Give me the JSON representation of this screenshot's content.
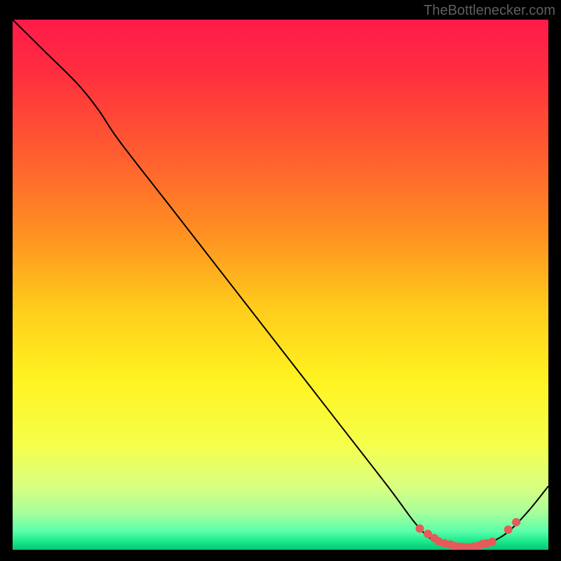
{
  "attribution": "TheBottlenecker.com",
  "chart_data": {
    "type": "line",
    "title": "",
    "xlabel": "",
    "ylabel": "",
    "xlim": [
      0,
      100
    ],
    "ylim": [
      0,
      100
    ],
    "series": [
      {
        "name": "curve",
        "x": [
          0,
          6,
          12,
          16,
          20,
          30,
          40,
          50,
          60,
          70,
          76,
          80,
          84,
          88,
          92,
          96,
          100
        ],
        "y": [
          100,
          94,
          88,
          83,
          77,
          64,
          51,
          38,
          25,
          12,
          4,
          1,
          0.5,
          1,
          3,
          7,
          12
        ]
      }
    ],
    "markers": {
      "name": "dots",
      "x": [
        76,
        77.5,
        78.7,
        79.5,
        80.6,
        81.7,
        82.5,
        83.5,
        84.2,
        85.0,
        86.0,
        87.0,
        87.8,
        88.5,
        89.5,
        92.5,
        94.0
      ],
      "y": [
        4.0,
        3.0,
        2.2,
        1.6,
        1.2,
        1.0,
        0.7,
        0.6,
        0.5,
        0.5,
        0.6,
        0.8,
        1.1,
        1.2,
        1.5,
        3.8,
        5.2
      ]
    },
    "gradient_stops": [
      {
        "offset": 0.0,
        "color": "#ff1b4a"
      },
      {
        "offset": 0.1,
        "color": "#ff2e3f"
      },
      {
        "offset": 0.25,
        "color": "#ff5c30"
      },
      {
        "offset": 0.4,
        "color": "#ff8f22"
      },
      {
        "offset": 0.55,
        "color": "#ffce1b"
      },
      {
        "offset": 0.68,
        "color": "#fff321"
      },
      {
        "offset": 0.8,
        "color": "#f6ff4b"
      },
      {
        "offset": 0.88,
        "color": "#d9ff80"
      },
      {
        "offset": 0.93,
        "color": "#a7ff9a"
      },
      {
        "offset": 0.965,
        "color": "#5cffab"
      },
      {
        "offset": 0.985,
        "color": "#17e88a"
      },
      {
        "offset": 1.0,
        "color": "#09c574"
      }
    ],
    "marker_color": "#e75a5a",
    "curve_color": "#000000"
  }
}
